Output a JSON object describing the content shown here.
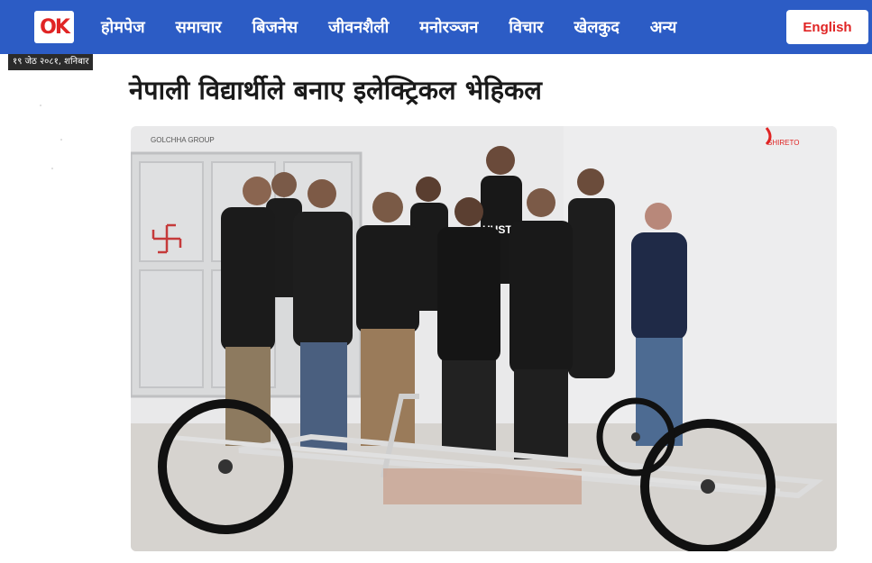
{
  "header": {
    "logo_text": "OK",
    "nav": [
      {
        "label": "होमपेज"
      },
      {
        "label": "समाचार"
      },
      {
        "label": "बिजनेस"
      },
      {
        "label": "जीवनशैली"
      },
      {
        "label": "मनोरञ्जन"
      },
      {
        "label": "विचार"
      },
      {
        "label": "खेलकुद"
      },
      {
        "label": "अन्य"
      }
    ],
    "lang_button": "English"
  },
  "date": "१९ जेठ २०८१, शनिबार",
  "article": {
    "title": "नेपाली विद्यार्थीले बनाए इलेक्ट्रिकल भेहिकल",
    "image": {
      "logo_left": "GOLCHHA GROUP",
      "logo_right": "SHIRETO",
      "shirt_text": "HUSTLE"
    }
  },
  "colors": {
    "brand_blue": "#2c5cc5",
    "accent_red": "#e02424"
  }
}
